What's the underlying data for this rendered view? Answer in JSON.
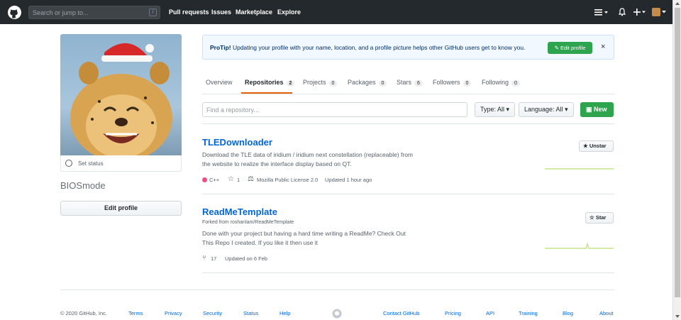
{
  "header": {
    "search_placeholder": "Search or jump to...",
    "search_shortcut": "/",
    "nav": [
      "Pull requests",
      "Issues",
      "Marketplace",
      "Explore"
    ]
  },
  "profile": {
    "status_text": "Set status",
    "username": "BIOSmode",
    "edit_label": "Edit profile"
  },
  "protip": {
    "bold": "ProTip!",
    "text": " Updating your profile with your name, location, and a profile picture helps other GitHub users get to know you.",
    "button": "Edit profile",
    "close": "×"
  },
  "tabs": [
    {
      "label": "Overview",
      "count": ""
    },
    {
      "label": "Repositories",
      "count": "2"
    },
    {
      "label": "Projects",
      "count": "0"
    },
    {
      "label": "Packages",
      "count": "0"
    },
    {
      "label": "Stars",
      "count": "6"
    },
    {
      "label": "Followers",
      "count": "0"
    },
    {
      "label": "Following",
      "count": "0"
    }
  ],
  "filters": {
    "find_placeholder": "Find a repository...",
    "type_label": "Type: All",
    "language_label": "Language: All",
    "new_label": "New"
  },
  "repos": [
    {
      "name": "TLEDownloader",
      "desc1": "Download the TLE data of iridium / iridium next constellation (replaceable) from",
      "desc2": "the website to realize the interface display based on QT.",
      "language": "C++",
      "stars": "1",
      "license": "Mozilla Public License 2.0",
      "updated": "Updated 1 hour ago",
      "star_button": "Unstar"
    },
    {
      "name": "ReadMeTemplate",
      "fork": "Forked from roshanlam/ReadMeTemplate",
      "desc1": "Done with your project but having a hard time writing a ReadMe? Check Out",
      "desc2": "This Repo I created. If you like it then use it",
      "forks": "17",
      "updated": "Updated on 6 Feb",
      "star_button": "Star"
    }
  ],
  "footer": {
    "copyright": "© 2020 GitHub, Inc.",
    "left_links": [
      "Terms",
      "Privacy",
      "Security",
      "Status",
      "Help"
    ],
    "right_links": [
      "Contact GitHub",
      "Pricing",
      "API",
      "Training",
      "Blog",
      "About"
    ]
  },
  "colors": {
    "header_bg": "#24292e",
    "accent_orange": "#e36209",
    "primary_green": "#2ea44f",
    "link_blue": "#0366d6",
    "cpp_lang": "#f34b7d"
  }
}
